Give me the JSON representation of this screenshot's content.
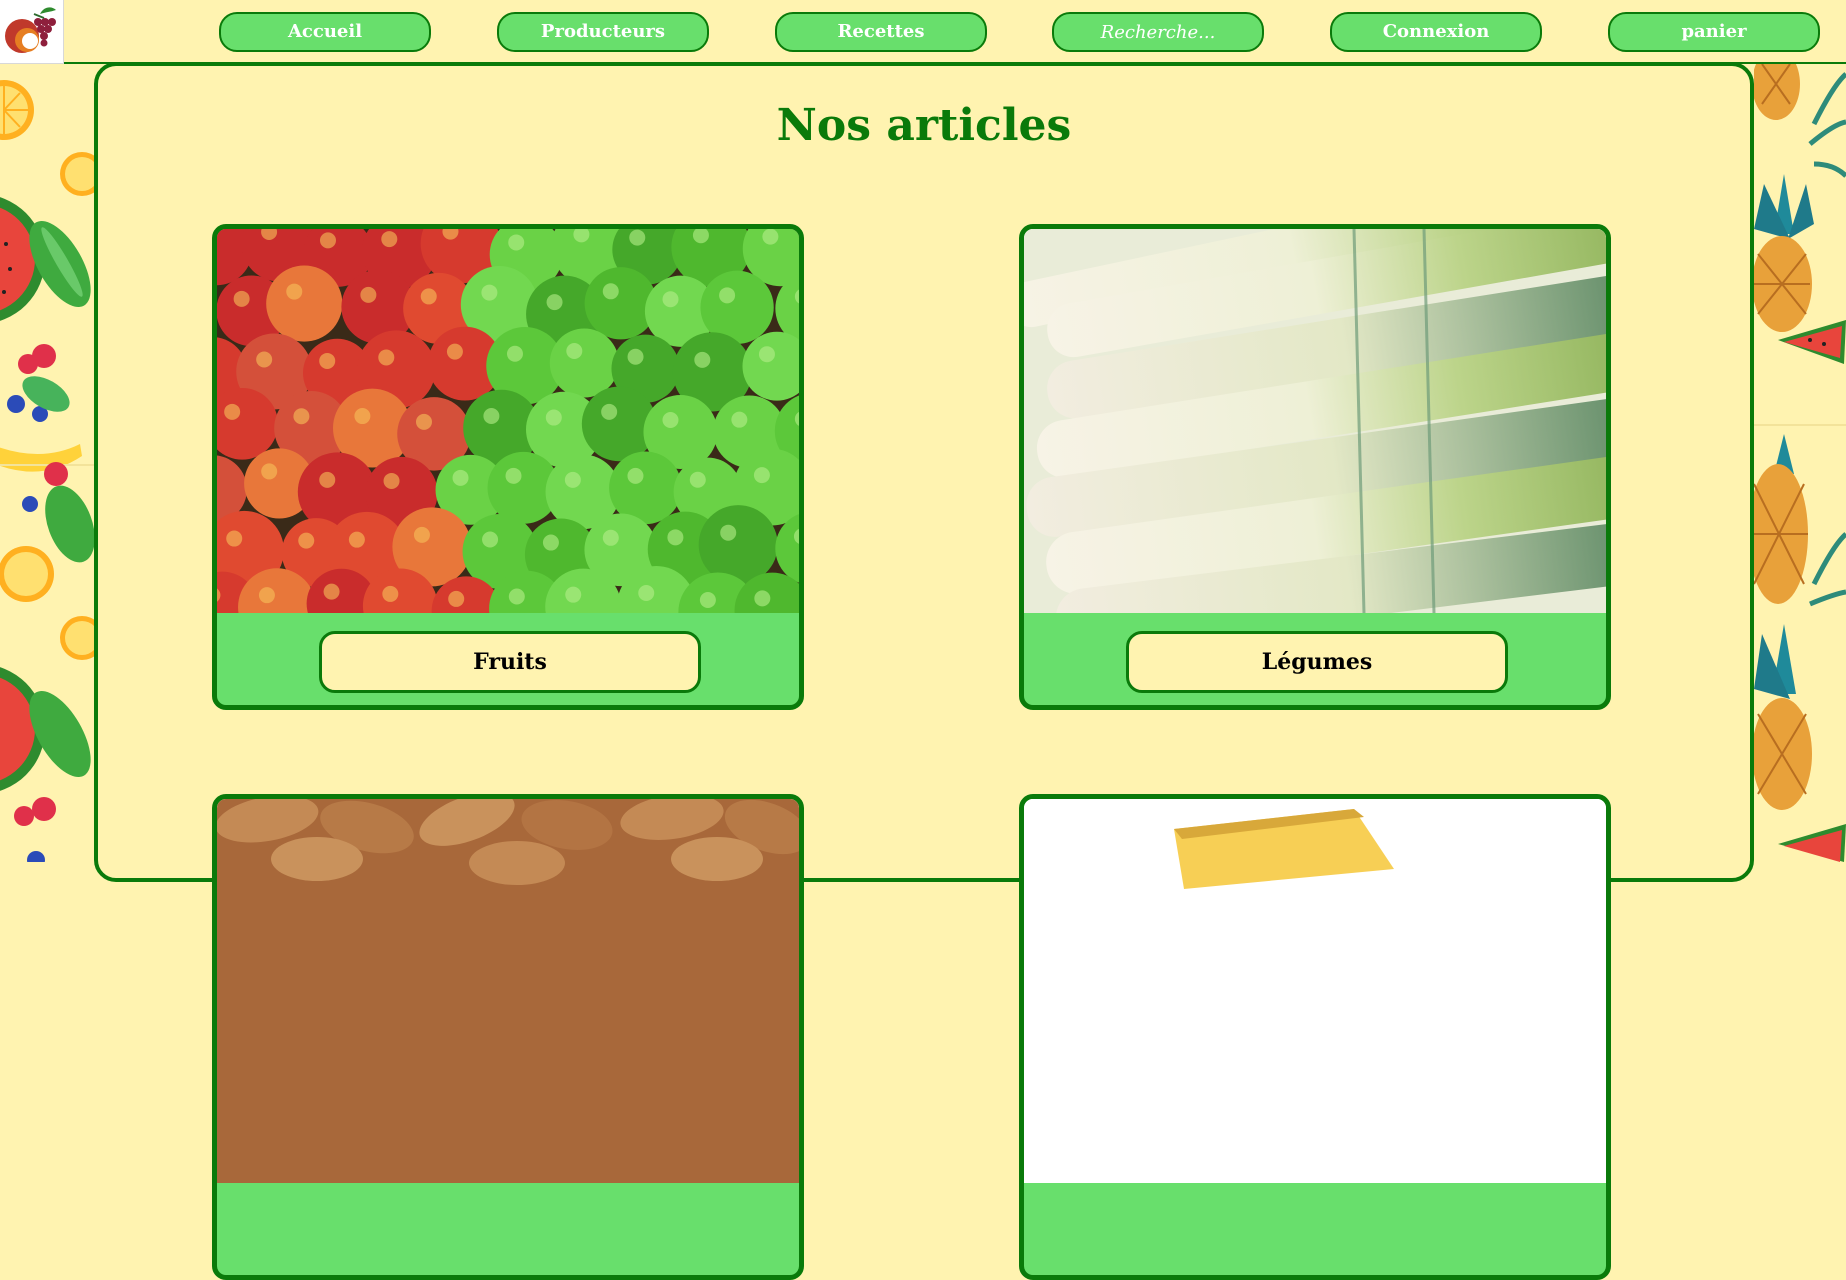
{
  "nav": {
    "home_label": "Accueil",
    "producers_label": "Producteurs",
    "recipes_label": "Recettes",
    "search_placeholder": "Recherche...",
    "login_label": "Connexion",
    "cart_label": "panier"
  },
  "main": {
    "title": "Nos articles",
    "cards": [
      {
        "label": "Fruits",
        "image": "apples-photo"
      },
      {
        "label": "Légumes",
        "image": "leeks-photo"
      },
      {
        "label": "",
        "image": "almonds-photo"
      },
      {
        "label": "",
        "image": "cheese-photo"
      }
    ]
  },
  "colors": {
    "background": "#fff3b0",
    "accent_green": "#0a7a0a",
    "button_green": "#68df6c",
    "nav_text": "#ffffff"
  }
}
